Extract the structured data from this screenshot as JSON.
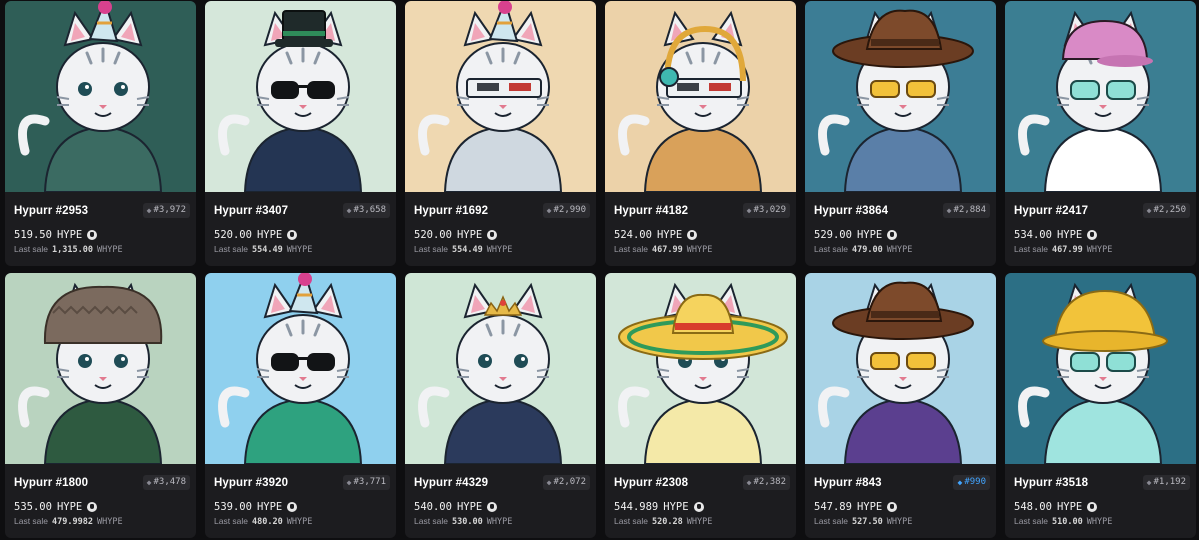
{
  "grid": {
    "last_sale_label": "Last sale",
    "items": [
      {
        "name": "Hypurr #2953",
        "rank": "#3,972",
        "price": "519.50",
        "currency": "HYPE",
        "last_sale": "1,315.00",
        "last_currency": "WHYPE",
        "bg": "#2f5e57",
        "fur": "#f1f2f4",
        "outfit": "#3b6b62",
        "accessory": "party-hat",
        "glasses": "none",
        "top_rank": false
      },
      {
        "name": "Hypurr #3407",
        "rank": "#3,658",
        "price": "520.00",
        "currency": "HYPE",
        "last_sale": "554.49",
        "last_currency": "WHYPE",
        "bg": "#d5e7da",
        "fur": "#f1f2f4",
        "outfit": "#243553",
        "accessory": "top-hat",
        "glasses": "sunglasses",
        "top_rank": false
      },
      {
        "name": "Hypurr #1692",
        "rank": "#2,990",
        "price": "520.00",
        "currency": "HYPE",
        "last_sale": "554.49",
        "last_currency": "WHYPE",
        "bg": "#efd8b1",
        "fur": "#f1f2f4",
        "outfit": "#cfd8e0",
        "accessory": "party-hat",
        "glasses": "visor",
        "top_rank": false
      },
      {
        "name": "Hypurr #4182",
        "rank": "#3,029",
        "price": "524.00",
        "currency": "HYPE",
        "last_sale": "467.99",
        "last_currency": "WHYPE",
        "bg": "#ecd2a9",
        "fur": "#f1f2f4",
        "outfit": "#d9a15a",
        "accessory": "headphones",
        "glasses": "visor",
        "top_rank": false
      },
      {
        "name": "Hypurr #3864",
        "rank": "#2,884",
        "price": "529.00",
        "currency": "HYPE",
        "last_sale": "479.00",
        "last_currency": "WHYPE",
        "bg": "#3c7d95",
        "fur": "#f1f2f4",
        "outfit": "#5a7fa8",
        "accessory": "cowboy-hat",
        "glasses": "yellow",
        "top_rank": false
      },
      {
        "name": "Hypurr #2417",
        "rank": "#2,250",
        "price": "534.00",
        "currency": "HYPE",
        "last_sale": "467.99",
        "last_currency": "WHYPE",
        "bg": "#3b7e92",
        "fur": "#f1f2f4",
        "outfit": "#ffffff",
        "accessory": "cap",
        "glasses": "teal",
        "top_rank": false
      },
      {
        "name": "Hypurr #1800",
        "rank": "#3,478",
        "price": "535.00",
        "currency": "HYPE",
        "last_sale": "479.9982",
        "last_currency": "WHYPE",
        "bg": "#b9d3bf",
        "fur": "#f1f2f4",
        "outfit": "#2e5a40",
        "accessory": "fur-hat",
        "glasses": "none",
        "top_rank": false
      },
      {
        "name": "Hypurr #3920",
        "rank": "#3,771",
        "price": "539.00",
        "currency": "HYPE",
        "last_sale": "480.20",
        "last_currency": "WHYPE",
        "bg": "#8fd0ee",
        "fur": "#f1f2f4",
        "outfit": "#2ea27f",
        "accessory": "party-hat",
        "glasses": "sunglasses",
        "top_rank": false
      },
      {
        "name": "Hypurr #4329",
        "rank": "#2,072",
        "price": "540.00",
        "currency": "HYPE",
        "last_sale": "530.00",
        "last_currency": "WHYPE",
        "bg": "#cfe6d6",
        "fur": "#f1f2f4",
        "outfit": "#2b3a5c",
        "accessory": "tiara",
        "glasses": "none",
        "top_rank": false
      },
      {
        "name": "Hypurr #2308",
        "rank": "#2,382",
        "price": "544.989",
        "currency": "HYPE",
        "last_sale": "520.28",
        "last_currency": "WHYPE",
        "bg": "#d2e6d8",
        "fur": "#f1f2f4",
        "outfit": "#f4e9a8",
        "accessory": "sombrero",
        "glasses": "none",
        "top_rank": false
      },
      {
        "name": "Hypurr #843",
        "rank": "#990",
        "price": "547.89",
        "currency": "HYPE",
        "last_sale": "527.50",
        "last_currency": "WHYPE",
        "bg": "#a9d3e6",
        "fur": "#f1f2f4",
        "outfit": "#5b3f8f",
        "accessory": "cowboy-hat",
        "glasses": "yellow",
        "top_rank": true
      },
      {
        "name": "Hypurr #3518",
        "rank": "#1,192",
        "price": "548.00",
        "currency": "HYPE",
        "last_sale": "510.00",
        "last_currency": "WHYPE",
        "bg": "#2c6f85",
        "fur": "#f1f2f4",
        "outfit": "#9fe4df",
        "accessory": "bucket-hat",
        "glasses": "teal",
        "top_rank": false
      }
    ]
  }
}
